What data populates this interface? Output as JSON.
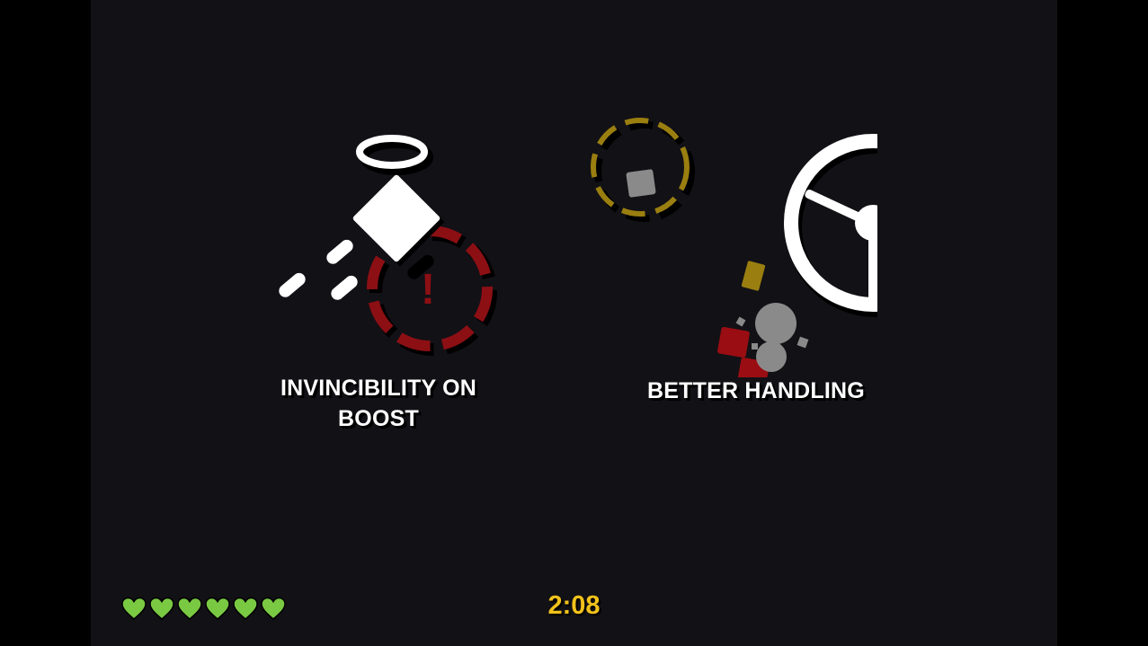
{
  "screen": {
    "type": "upgrade-selection",
    "background_color": "#121116",
    "letterbox_color": "#000000"
  },
  "upgrades": [
    {
      "label": "INVINCIBILITY ON\nBOOST",
      "icon": "halo-boost-invincibility-icon",
      "warning_glyph": "!",
      "colors": {
        "primary": "#ffffff",
        "accent": "#8c0f14"
      }
    },
    {
      "label": "BETTER HANDLING",
      "icon": "steering-wheel-icon",
      "colors": {
        "primary": "#ffffff",
        "accent": "#9a7f10",
        "debris": "#8a8a8a",
        "damage": "#9a0d12"
      }
    }
  ],
  "hud": {
    "lives": 6,
    "heart_color": "#7ac943",
    "timer": "2:08",
    "timer_color": "#f2c21b"
  }
}
